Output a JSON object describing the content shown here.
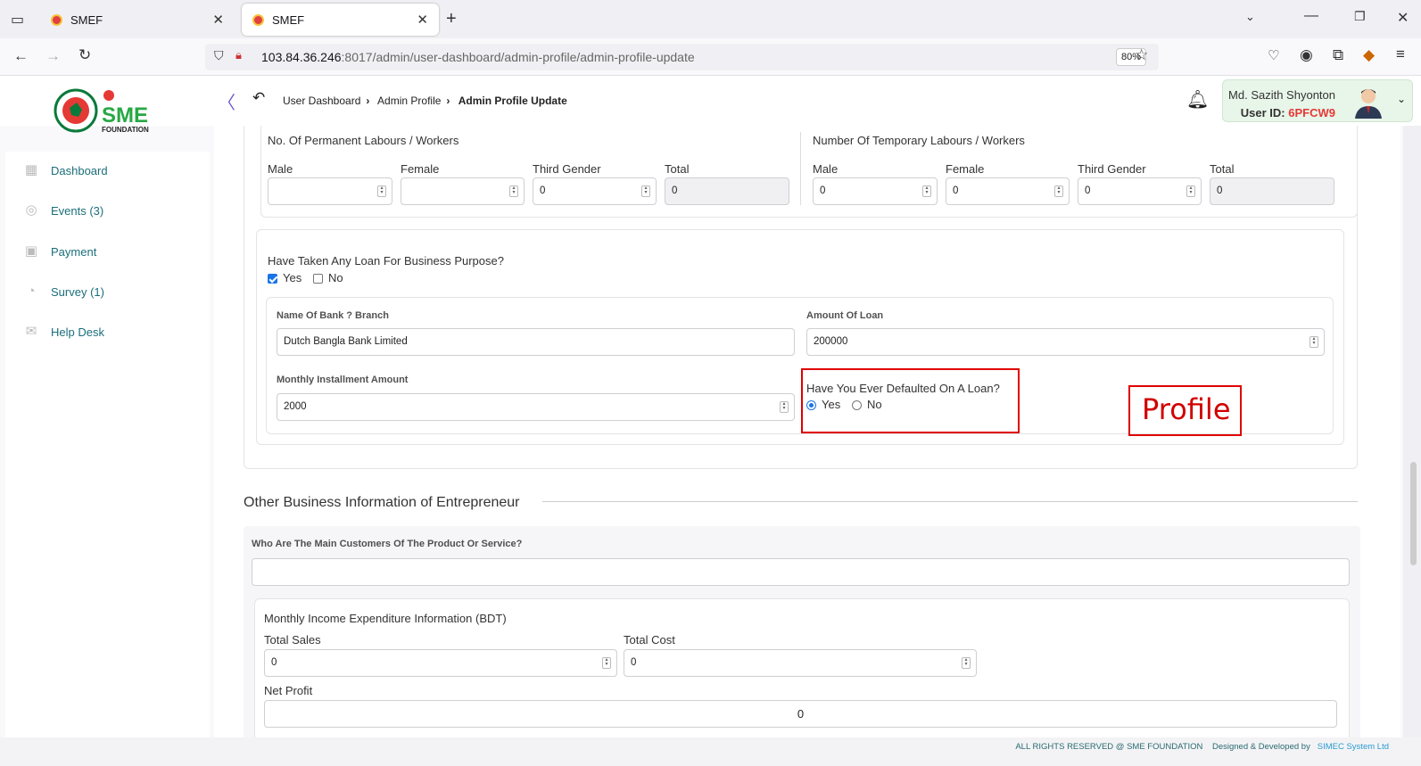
{
  "browser": {
    "tabs": [
      {
        "label": "SMEF"
      },
      {
        "label": "SMEF"
      }
    ],
    "url_host": "103.84.36.246",
    "url_path": ":8017/admin/user-dashboard/admin-profile/admin-profile-update",
    "zoom": "80%"
  },
  "header": {
    "breadcrumb": [
      "User Dashboard",
      "Admin Profile",
      "Admin Profile Update"
    ],
    "user_name": "Md. Sazith Shyonton",
    "user_id_label": "User ID:",
    "user_id": "6PFCW9"
  },
  "logo": {
    "text": "SME",
    "sub": "FOUNDATION"
  },
  "sidebar": {
    "items": [
      {
        "label": "Dashboard",
        "icon": "grid-icon"
      },
      {
        "label": "Events (3)",
        "icon": "events-icon"
      },
      {
        "label": "Payment",
        "icon": "payment-icon"
      },
      {
        "label": "Survey (1)",
        "icon": "survey-icon"
      },
      {
        "label": "Help Desk",
        "icon": "mail-icon"
      }
    ]
  },
  "labours": {
    "permanent": {
      "title": "No. Of Permanent Labours / Workers",
      "male_label": "Male",
      "male": "",
      "female_label": "Female",
      "female": "",
      "third_label": "Third Gender",
      "third": "0",
      "total_label": "Total",
      "total": "0"
    },
    "temporary": {
      "title": "Number Of Temporary Labours / Workers",
      "male_label": "Male",
      "male": "0",
      "female_label": "Female",
      "female": "0",
      "third_label": "Third Gender",
      "third": "0",
      "total_label": "Total",
      "total": "0"
    }
  },
  "loan": {
    "question": "Have Taken Any Loan For Business Purpose?",
    "yes": "Yes",
    "no": "No",
    "bank_label": "Name Of Bank ? Branch",
    "bank": "Dutch Bangla Bank Limited",
    "amount_label": "Amount Of Loan",
    "amount": "200000",
    "installment_label": "Monthly Installment Amount",
    "installment": "2000",
    "default_question": "Have You Ever Defaulted On A Loan?",
    "default_yes": "Yes",
    "default_no": "No"
  },
  "annotation": "Profile",
  "other": {
    "section_title": "Other Business Information of Entrepreneur",
    "customers_label": "Who Are The Main Customers Of The Product Or Service?",
    "customers": "",
    "income_title": "Monthly Income Expenditure Information (BDT)",
    "sales_label": "Total Sales",
    "sales": "0",
    "cost_label": "Total Cost",
    "cost": "0",
    "profit_label": "Net Profit",
    "profit": "0"
  },
  "footer": {
    "rights": "ALL RIGHTS RESERVED @ SME FOUNDATION",
    "designed": "Designed & Developed by",
    "company": "SIMEC System Ltd"
  }
}
